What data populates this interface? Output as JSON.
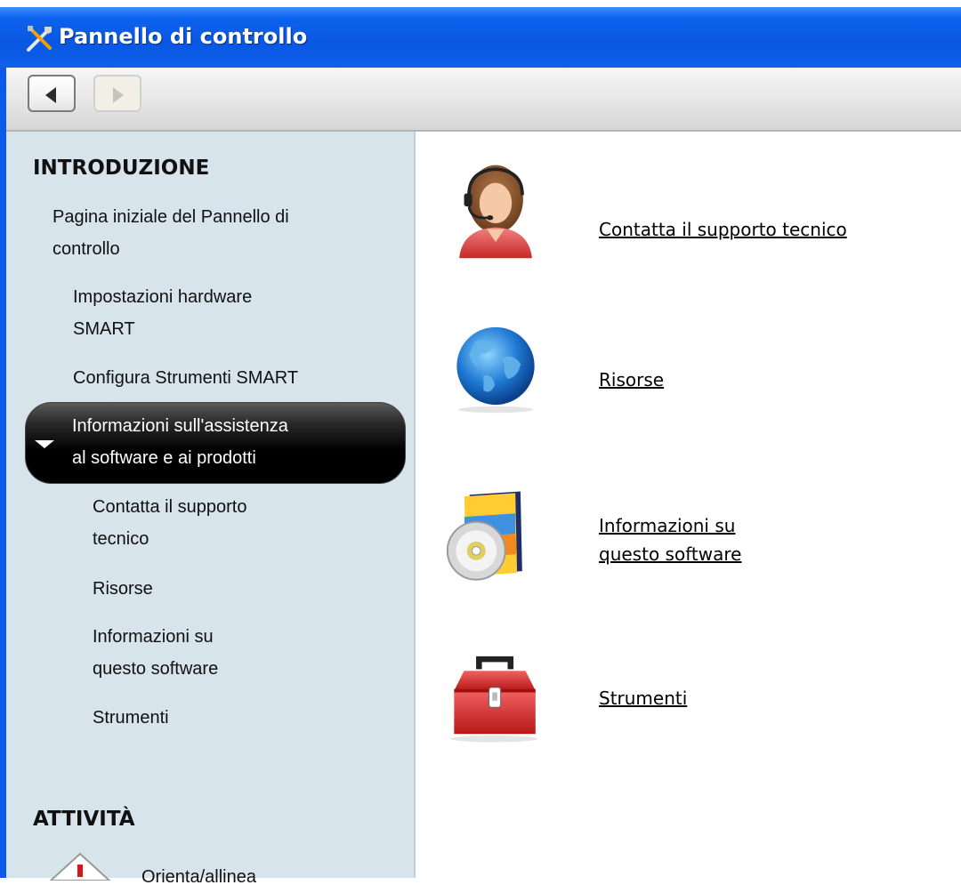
{
  "window": {
    "title": "Pannello di controllo"
  },
  "toolbar": {
    "back_icon": "back-arrow-icon",
    "forward_icon": "forward-arrow-icon"
  },
  "sidebar": {
    "section_intro": "INTRODUZIONE",
    "items": [
      {
        "line1": "Pagina iniziale del Pannello di",
        "line2": "controllo"
      },
      {
        "line1": "Impostazioni hardware",
        "line2": "SMART"
      },
      {
        "line1": "Configura Strumenti SMART"
      },
      {
        "line1": "Informazioni sull'assistenza",
        "line2": "al software e ai prodotti",
        "selected": true
      },
      {
        "line1": "Contatta il supporto",
        "line2": "tecnico"
      },
      {
        "line1": "Risorse"
      },
      {
        "line1": "Informazioni su",
        "line2": "questo software"
      },
      {
        "line1": "Strumenti"
      }
    ],
    "section_tasks": "ATTIVITÀ",
    "task_item": "Orienta/allinea"
  },
  "content": {
    "items": [
      {
        "label": "Contatta il supporto tecnico",
        "icon": "support-agent-icon"
      },
      {
        "label": "Risorse",
        "icon": "globe-icon"
      },
      {
        "line1": "Informazioni su",
        "line2": "questo software",
        "icon": "software-box-icon"
      },
      {
        "label": "Strumenti",
        "icon": "toolbox-icon"
      }
    ]
  },
  "colors": {
    "titlebar": "#0a58e2",
    "sidebar": "#d8e4ec",
    "selected_bg": "#000000"
  }
}
